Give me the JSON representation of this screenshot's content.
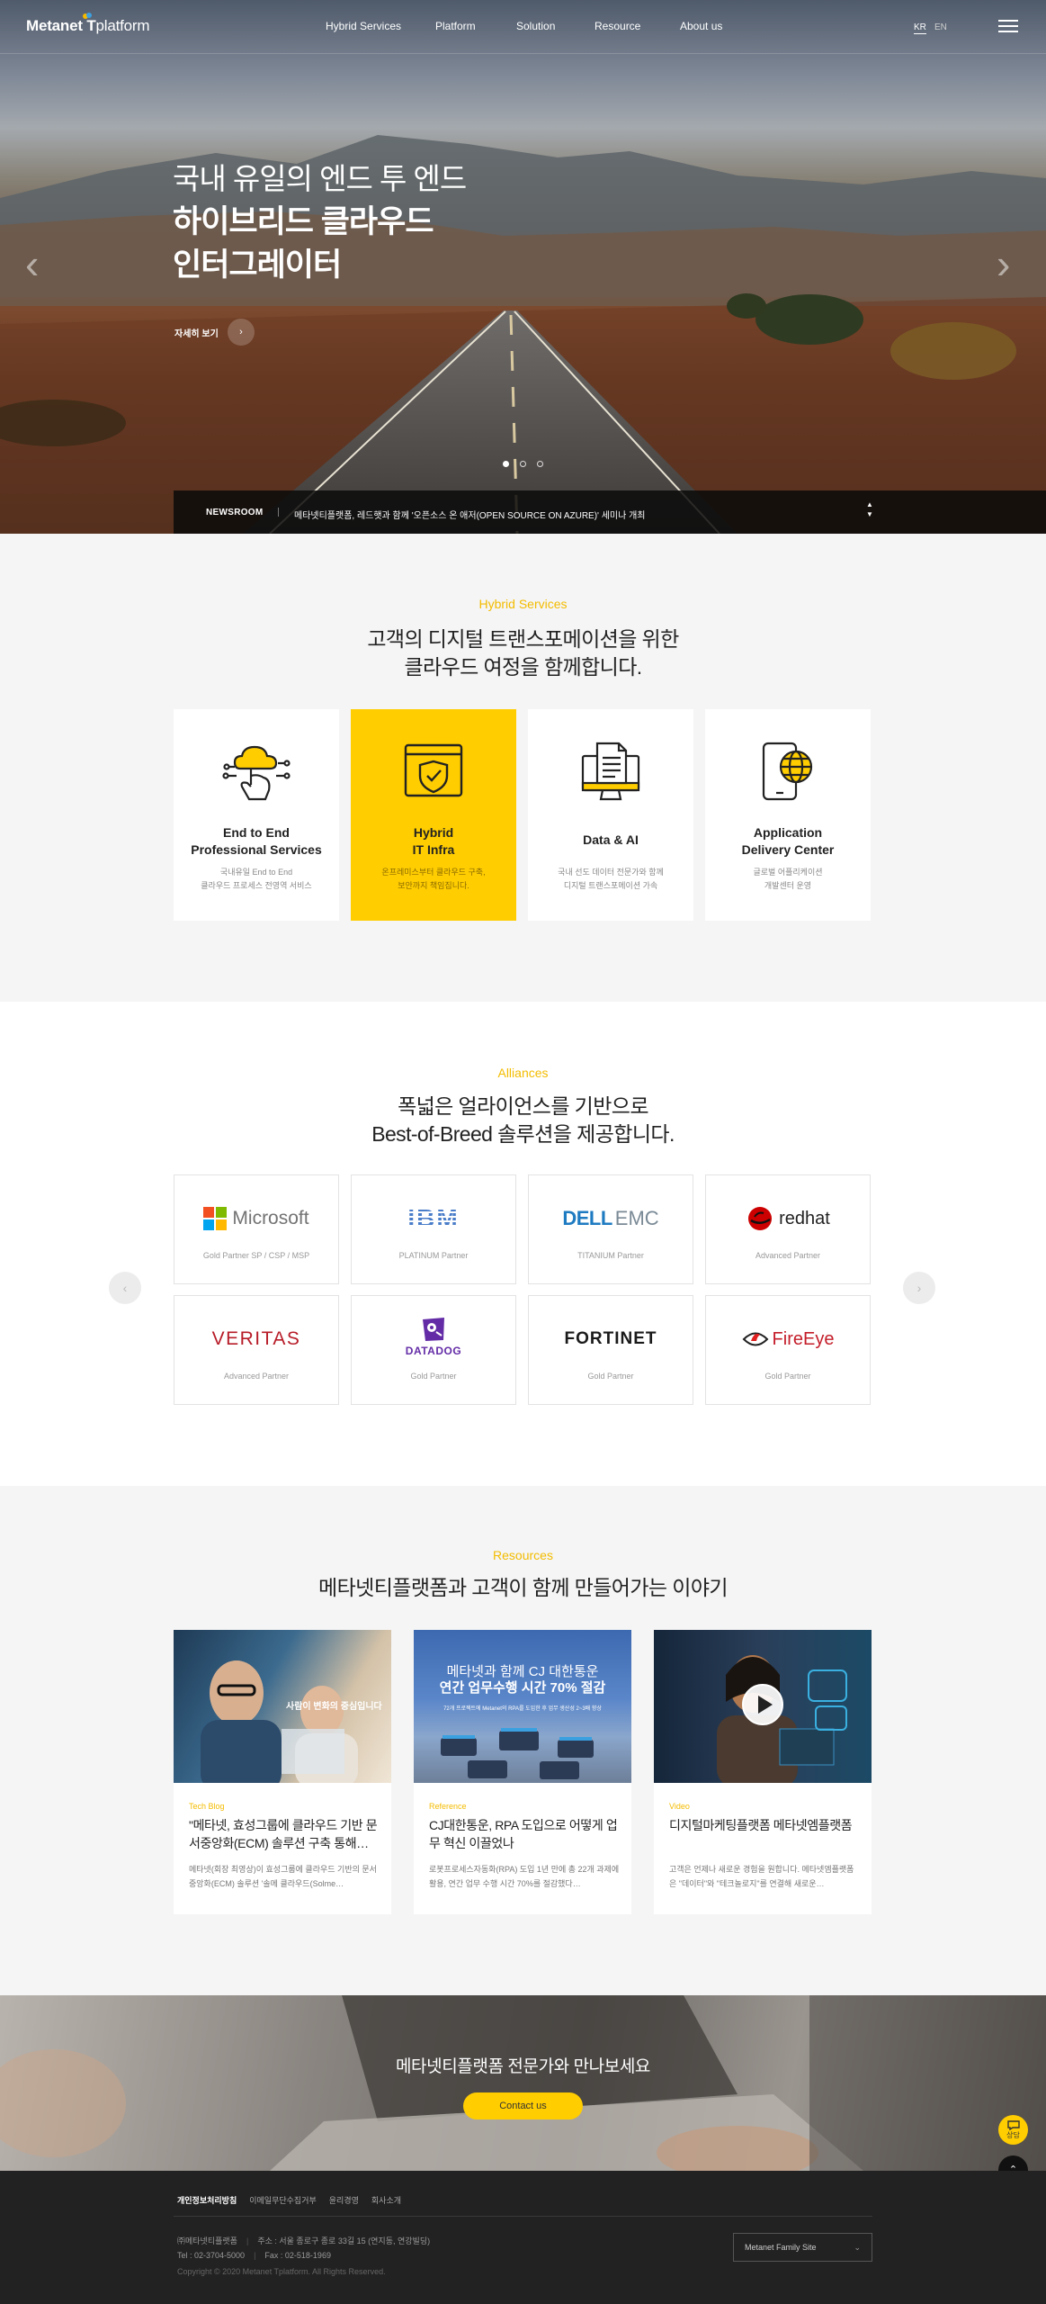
{
  "header": {
    "logo_main": "Metanet ",
    "logo_t": "T",
    "logo_sub": "platform",
    "nav": [
      "Hybrid Services",
      "Platform",
      "Solution",
      "Resource",
      "About us"
    ],
    "lang_kr": "KR",
    "lang_en": "EN"
  },
  "hero": {
    "line1": "국내 유일의 엔드 투 엔드",
    "line2": "하이브리드 클라우드",
    "line3": "인터그레이터",
    "detail_label": "자세히 보기",
    "slide_count": 3,
    "active_slide": 1
  },
  "newsroom": {
    "label": "NEWSROOM",
    "headline": "메타넷티플랫폼, 레드햇과 함께 '오픈소스 온 애저(OPEN SOURCE ON AZURE)' 세미나 개최"
  },
  "hybrid": {
    "tag": "Hybrid Services",
    "title_line1": "고객의 디지털 트랜스포메이션을 위한",
    "title_line2": "클라우드 여정을 함께합니다.",
    "cards": [
      {
        "title1": "End to End",
        "title2": "Professional Services",
        "desc1": "국내유일 End to End",
        "desc2": "클라우드 프로세스 전영역 서비스",
        "icon": "cloud-hand-icon"
      },
      {
        "title1": "Hybrid",
        "title2": "IT Infra",
        "desc1": "온프레미스부터 클라우드 구축,",
        "desc2": "보안까지 책임집니다.",
        "icon": "shield-check-icon"
      },
      {
        "title1": "Data & AI",
        "title2": "",
        "desc1": "국내 선도 데이터 전문가와 함께",
        "desc2": "디지털 트랜스포메이션 가속",
        "icon": "monitor-document-icon"
      },
      {
        "title1": "Application",
        "title2": "Delivery Center",
        "desc1": "글로벌 어플리케이션",
        "desc2": "개발센터 운영",
        "icon": "phone-globe-icon"
      }
    ]
  },
  "alliances": {
    "tag": "Alliances",
    "title_line1": "폭넓은 얼라이언스를 기반으로",
    "title_line2": "Best-of-Breed 솔루션을 제공합니다.",
    "partners": [
      {
        "logo": "Microsoft",
        "level": "Gold Partner SP / CSP / MSP"
      },
      {
        "logo": "IBM",
        "level": "PLATINUM Partner"
      },
      {
        "logo_a": "DELL",
        "logo_b": "EMC",
        "level": "TITANIUM Partner"
      },
      {
        "logo": "redhat",
        "level": "Advanced Partner"
      },
      {
        "logo": "VERITAS",
        "level": "Advanced Partner"
      },
      {
        "logo": "DATADOG",
        "level": "Gold Partner"
      },
      {
        "logo": "FORTINET",
        "level": "Gold Partner"
      },
      {
        "logo": "FireEye",
        "level": "Gold Partner"
      }
    ]
  },
  "resources": {
    "tag": "Resources",
    "title": "메타넷티플랫폼과 고객이 함께 만들어가는 이야기",
    "cards": [
      {
        "category": "Tech Blog",
        "image_caption": "사람이 변화의 중심입니다",
        "title": "\"메타넷, 효성그룹에 클라우드 기반 문서중앙화(ECM) 솔루션 구축 통해…",
        "desc": "메타넷(회장 최영상)이 효성그룹에 클라우드 기반의 문서 중앙화(ECM) 솔루션 '솔메 클라우드(Solme…"
      },
      {
        "category": "Reference",
        "image_caption_1": "메타넷과 함께 CJ 대한통운",
        "image_caption_2": "연간 업무수행 시간 70% 절감",
        "image_caption_3": "72개 프로젝트에 Metanet의 RPA를 도입한 후 업무 생산성 2~3배 향상",
        "title": "CJ대한통운, RPA 도입으로 어떻게 업무 혁신 이끌었나",
        "desc": "로봇프로세스자동화(RPA) 도입 1년 만에 총 22개 과제에 활용, 연간 업무 수행 시간 70%를 절감했다…"
      },
      {
        "category": "Video",
        "title": "디지털마케팅플랫폼 메타넷엠플랫폼",
        "desc": "고객은 언제나 새로운 경험을 원합니다. 메타넷엠플랫폼은 \"데이터\"와 \"테크놀로지\"를 연결해 새로운…"
      }
    ]
  },
  "cta": {
    "title": "메타넷티플랫폼 전문가와 만나보세요",
    "button": "Contact us",
    "quick_label": "상담"
  },
  "footer": {
    "links": [
      "개인정보처리방침",
      "이메일무단수집거부",
      "윤리경영",
      "회사소개"
    ],
    "company": "㈜메타넷티플랫폼",
    "address": "주소 : 서울 종로구 종로 33길 15 (연지동, 연강빌딩)",
    "tel": "Tel : 02-3704-5000",
    "fax": "Fax : 02-518-1969",
    "copyright": "Copyright © 2020 Metanet Tplatform. All Rights Reserved.",
    "family_site": "Metanet Family Site"
  },
  "colors": {
    "accent": "#ffcd00",
    "tag": "#f3bc00",
    "footer": "#222222"
  }
}
